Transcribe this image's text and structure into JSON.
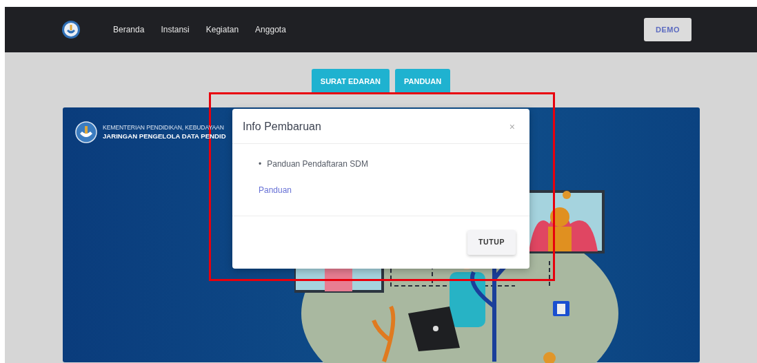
{
  "navbar": {
    "links": [
      {
        "label": "Beranda"
      },
      {
        "label": "Instansi"
      },
      {
        "label": "Kegiatan"
      },
      {
        "label": "Anggota"
      }
    ],
    "demo_button": "DEMO"
  },
  "action_buttons": [
    "SURAT EDARAN",
    "PANDUAN"
  ],
  "banner": {
    "line_1": "KEMENTERIAN PENDIDIKAN, KEBUDAYAAN",
    "line_2": "JARINGAN PENGELOLA DATA PENDID"
  },
  "modal": {
    "title": "Info Pembaruan",
    "close": "×",
    "items": [
      {
        "bullet": "•",
        "text": "Panduan Pendaftaran SDM"
      }
    ],
    "link": "Panduan",
    "footer_button": "TUTUP"
  }
}
